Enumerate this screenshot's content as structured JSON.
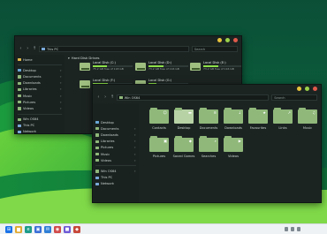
{
  "colors": {
    "accent": "#8ee04a",
    "folder": "#8fb87a",
    "window_bg": "#1c2422",
    "sidebar_bg": "#1a2220"
  },
  "window_back": {
    "address": "This PC",
    "search_placeholder": "Search",
    "section_title": "Hard Disk Drives",
    "sidebar": [
      {
        "label": "Home",
        "icon": "home-icon"
      },
      {
        "label": "Desktop",
        "icon": "desktop-icon"
      },
      {
        "label": "Documents",
        "icon": "documents-icon"
      },
      {
        "label": "Downloads",
        "icon": "downloads-icon"
      },
      {
        "label": "Libraries",
        "icon": "libraries-icon"
      },
      {
        "label": "Music",
        "icon": "music-icon"
      },
      {
        "label": "Pictures",
        "icon": "pictures-icon"
      },
      {
        "label": "Videos",
        "icon": "videos-icon"
      },
      {
        "label": "Win OS64",
        "icon": "drive-icon"
      },
      {
        "label": "This PC",
        "icon": "pc-icon"
      },
      {
        "label": "Network",
        "icon": "network-icon"
      }
    ],
    "drives": [
      {
        "name": "Local Disk (C:)",
        "free": "75.2 GB free of 118 GB",
        "used": 0.36
      },
      {
        "name": "Local Disk (D:)",
        "free": "73.2 GB free of 116 GB",
        "used": 0.37
      },
      {
        "name": "Local Disk (E:)",
        "free": "73.2 GB free of 116 GB",
        "used": 0.37
      },
      {
        "name": "Local Disk (F:)",
        "free": "73.2 GB free of 116 GB",
        "used": 0.37
      },
      {
        "name": "Local Disk (G:)",
        "free": "91.4 GB free of 116 GB",
        "used": 0.21
      }
    ]
  },
  "window_front": {
    "address": "Win OS64",
    "search_placeholder": "Search",
    "sidebar": [
      {
        "label": "Desktop",
        "icon": "desktop-icon"
      },
      {
        "label": "Documents",
        "icon": "documents-icon"
      },
      {
        "label": "Downloads",
        "icon": "downloads-icon"
      },
      {
        "label": "Libraries",
        "icon": "libraries-icon"
      },
      {
        "label": "Pictures",
        "icon": "pictures-icon"
      },
      {
        "label": "Music",
        "icon": "music-icon"
      },
      {
        "label": "Videos",
        "icon": "videos-icon"
      },
      {
        "label": "Win OS64",
        "icon": "drive-icon"
      },
      {
        "label": "This PC",
        "icon": "pc-icon"
      },
      {
        "label": "Network",
        "icon": "network-icon"
      }
    ],
    "folders": [
      {
        "label": "Contacts",
        "glyph": "☺",
        "icon": "contacts-folder-icon"
      },
      {
        "label": "Desktop",
        "glyph": "▬",
        "icon": "desktop-folder-icon"
      },
      {
        "label": "Documents",
        "glyph": "≡",
        "icon": "documents-folder-icon"
      },
      {
        "label": "Downloads",
        "glyph": "↓",
        "icon": "downloads-folder-icon"
      },
      {
        "label": "Favourites",
        "glyph": "★",
        "icon": "favourites-folder-icon"
      },
      {
        "label": "Links",
        "glyph": "↗",
        "icon": "links-folder-icon"
      },
      {
        "label": "Music",
        "glyph": "♫",
        "icon": "music-folder-icon"
      },
      {
        "label": "Pictures",
        "glyph": "▣",
        "icon": "pictures-folder-icon"
      },
      {
        "label": "Saved Games",
        "glyph": "◆",
        "icon": "saved-games-folder-icon"
      },
      {
        "label": "Searches",
        "glyph": "⌕",
        "icon": "searches-folder-icon"
      },
      {
        "label": "Videos",
        "glyph": "▶",
        "icon": "videos-folder-icon"
      }
    ]
  },
  "taskbar": {
    "apps": [
      {
        "icon": "start-icon",
        "glyph": "⊞",
        "color": "#1a73e8"
      },
      {
        "icon": "file-explorer-icon",
        "glyph": "▆",
        "color": "#e0a82e"
      },
      {
        "icon": "edge-icon",
        "glyph": "e",
        "color": "#1e9c8a"
      },
      {
        "icon": "store-icon",
        "glyph": "▣",
        "color": "#3a6fd8"
      },
      {
        "icon": "mail-icon",
        "glyph": "✉",
        "color": "#2f7fd6"
      },
      {
        "icon": "photos-icon",
        "glyph": "◉",
        "color": "#d14b4b"
      },
      {
        "icon": "app-icon",
        "glyph": "■",
        "color": "#6e5bd6"
      },
      {
        "icon": "app2-icon",
        "glyph": "◆",
        "color": "#c7483a"
      }
    ]
  }
}
